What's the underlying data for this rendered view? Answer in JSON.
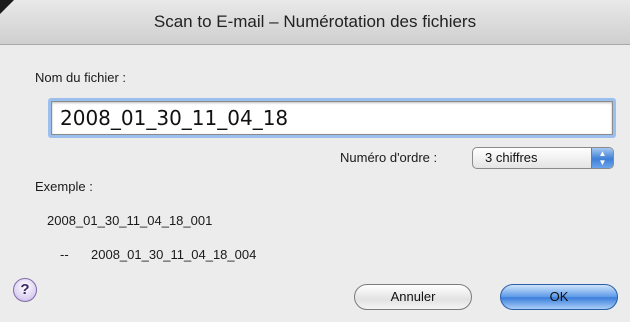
{
  "window": {
    "title": "Scan to E-mail – Numérotation des fichiers"
  },
  "filename": {
    "label": "Nom du fichier :",
    "value": "2008_01_30_11_04_18"
  },
  "order": {
    "label": "Numéro d'ordre :",
    "selected": "3 chiffres",
    "arrows_icon": "updown-arrows-icon"
  },
  "example": {
    "label": "Exemple :",
    "first": "2008_01_30_11_04_18_001",
    "separator": "--",
    "last": "2008_01_30_11_04_18_004"
  },
  "buttons": {
    "help": "?",
    "cancel": "Annuler",
    "ok": "OK"
  },
  "colors": {
    "focus_ring": "#9cc0ee",
    "default_button": "#3a7ddc"
  }
}
